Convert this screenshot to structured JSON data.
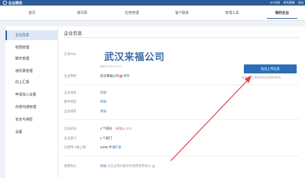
{
  "header": {
    "brand": "企业微信",
    "links": [
      "API文档",
      "联系客服",
      "退出"
    ]
  },
  "nav": {
    "items": [
      "首页",
      "通讯录",
      "应用管理",
      "客户联系",
      "管理工具",
      "我的企业"
    ],
    "active": "我的企业"
  },
  "sidebar": {
    "items": [
      "企业信息",
      "权限管理",
      "聊天管理",
      "通讯录管理",
      "向上汇报",
      "申请加入设置",
      "外部沟通管理",
      "安全与保密",
      "设置"
    ],
    "active": "企业信息"
  },
  "main": {
    "title": "企业信息",
    "logo_label": "企业logo",
    "logo_text": "武汉来福公司",
    "logo_caption": "推荐尺寸为702*180",
    "short_name_label": "企业简称",
    "short_name_value": "武汉来福公司",
    "short_name_edit": "修改",
    "upload_button": "验证上传信息",
    "upload_hint": "验证身份上传真实的企业信息可享用",
    "address_label": "企业地址",
    "address_value": "添加",
    "service_label": "服务地区",
    "service_value": "添加",
    "domain_label": "企业域名",
    "domain_value": "添加",
    "members_label": "企业成员",
    "members_value": "4 个成员",
    "members_note": "（未加入 2人）",
    "departments_label": "企业部门",
    "departments_value": "1 个部门",
    "purchased_label": "已使用人数上限",
    "purchased_value": "4/200",
    "purchased_link": "申请扩容",
    "invoice_label": "发票抬头",
    "invoice_value": "添加",
    "invoice_note": "为企业购买服务时使用发票抬头"
  },
  "colors": {
    "brand": "#2c5c95",
    "link": "#2c6fb5",
    "warning": "#e04545",
    "arrow": "#e04545"
  }
}
